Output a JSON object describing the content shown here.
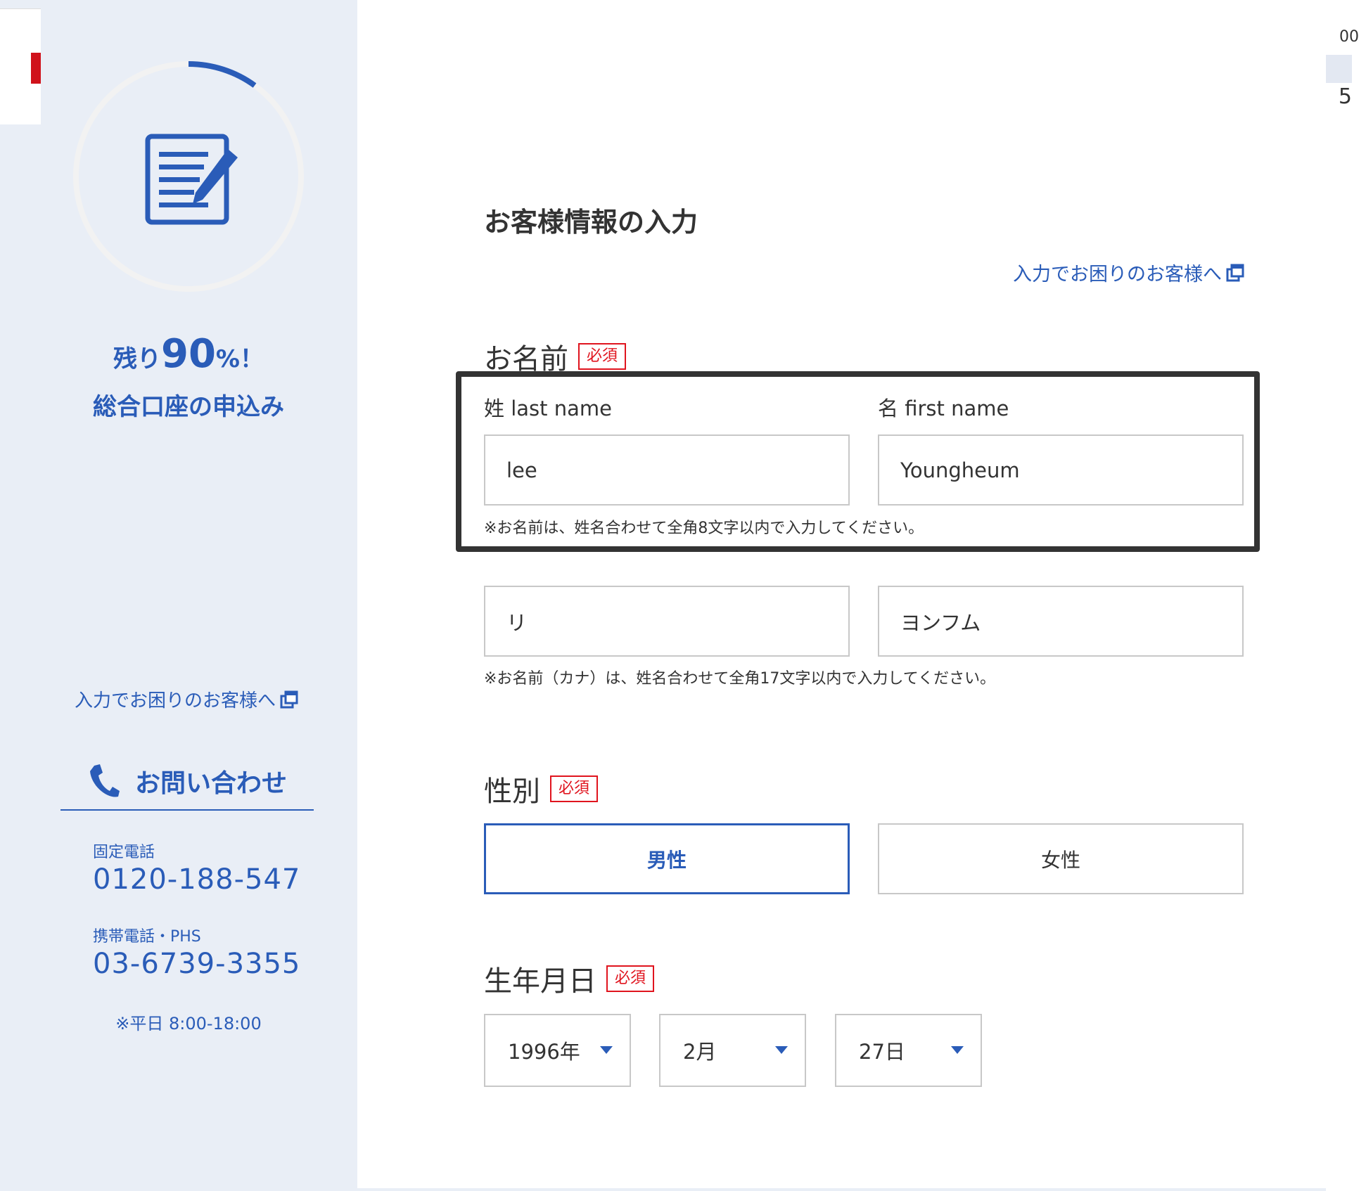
{
  "background": {
    "right_text_top": "00",
    "right_text_bottom": "5"
  },
  "sidebar": {
    "progress": {
      "remaining_fraction": 0.9
    },
    "remaining_prefix": "残り",
    "remaining_value": "90",
    "remaining_suffix": "%！",
    "subtitle": "総合口座の申込み",
    "help_link": "入力でお困りのお客様へ",
    "contact_title": "お問い合わせ",
    "landline_label": "固定電話",
    "landline_number": "0120-188-547",
    "mobile_label": "携帯電話・PHS",
    "mobile_number": "03-6739-3355",
    "hours": "※平日 8:00-18:00"
  },
  "form": {
    "title": "お客様情報の入力",
    "help_link": "入力でお困りのお客様へ",
    "required_badge": "必須",
    "name": {
      "label": "お名前",
      "last_name_label": "姓 last name",
      "first_name_label": "名 first name",
      "last_name_value": "lee",
      "first_name_value": "Youngheum",
      "note": "※お名前は、姓名合わせて全角8文字以内で入力してください。",
      "last_name_kana_value": "リ",
      "first_name_kana_value": "ヨンフム",
      "kana_note": "※お名前（カナ）は、姓名合わせて全角17文字以内で入力してください。"
    },
    "gender": {
      "label": "性別",
      "male": "男性",
      "female": "女性",
      "selected": "男性"
    },
    "birthdate": {
      "label": "生年月日",
      "year": "1996年",
      "month": "2月",
      "day": "27日"
    }
  },
  "colors": {
    "accent": "#2a5cb8",
    "required": "#e0141e",
    "sidebar_bg": "#e9eef6"
  }
}
